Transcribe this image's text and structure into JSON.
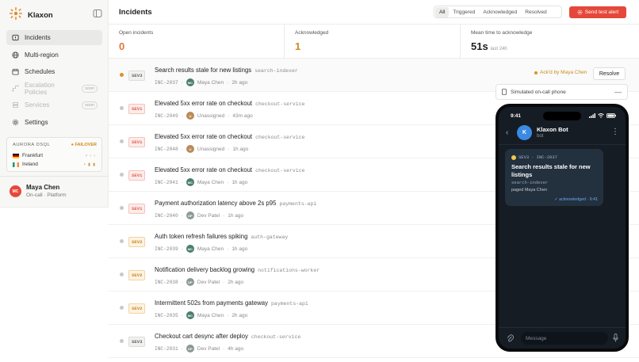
{
  "app": {
    "name": "Klaxon"
  },
  "sidebar": {
    "items": [
      {
        "label": "Incidents",
        "icon": "alert-triangle-icon",
        "active": true
      },
      {
        "label": "Multi-region",
        "icon": "globe-icon"
      },
      {
        "label": "Schedules",
        "icon": "calendar-icon"
      },
      {
        "label": "Escalation Policies",
        "icon": "escalation-icon",
        "disabled": true,
        "badge": "soon"
      },
      {
        "label": "Services",
        "icon": "server-icon",
        "disabled": true,
        "badge": "soon"
      },
      {
        "label": "Settings",
        "icon": "gear-icon"
      }
    ],
    "aurora": {
      "title": "AURORA DSQL",
      "status": "FAILOVER",
      "regions": [
        {
          "name": "Frankfurt",
          "flag": "DE",
          "state": "• ‹ ‹"
        },
        {
          "name": "Ireland",
          "flag": "IE",
          "state": "• ▮ ▮"
        }
      ]
    },
    "user": {
      "initials": "MC",
      "name": "Maya Chen",
      "role": "On-call · Platform"
    }
  },
  "header": {
    "title": "Incidents",
    "filters": [
      "All",
      "Triggered",
      "Acknowledged",
      "Resolved"
    ],
    "active_filter": "All",
    "send_test": "Send test alert"
  },
  "stats": [
    {
      "label": "Open incidents",
      "value": "0",
      "color": "#e2753d"
    },
    {
      "label": "Acknowledged",
      "value": "1",
      "color": "#c98c1d"
    },
    {
      "label": "Mean time to acknowledge",
      "value": "51s",
      "sub": "last 24h",
      "color": "#1f1f1f"
    }
  ],
  "incidents": [
    {
      "sev": "SEV3",
      "title": "Search results stale for new listings",
      "service": "search-indexer",
      "id": "INC-2037",
      "assignee": "Maya Chen",
      "initials": "MC",
      "time": "2h ago",
      "ack": "Ack'd by Maya Chen",
      "resolve": "Resolve",
      "dot": "#d9941c"
    },
    {
      "sev": "SEV1",
      "title": "Elevated 5xx error rate on checkout",
      "service": "checkout-service",
      "id": "INC-2049",
      "assignee": "Unassigned",
      "initials": "U",
      "time": "43m ago",
      "dot": "#c9c9c9"
    },
    {
      "sev": "SEV1",
      "title": "Elevated 5xx error rate on checkout",
      "service": "checkout-service",
      "id": "INC-2048",
      "assignee": "Unassigned",
      "initials": "U",
      "time": "1h ago",
      "dot": "#c9c9c9"
    },
    {
      "sev": "SEV1",
      "title": "Elevated 5xx error rate on checkout",
      "service": "checkout-service",
      "id": "INC-2041",
      "assignee": "Maya Chen",
      "initials": "MC",
      "time": "1h ago",
      "dot": "#c9c9c9"
    },
    {
      "sev": "SEV1",
      "title": "Payment authorization latency above 2s p95",
      "service": "payments-api",
      "id": "INC-2040",
      "assignee": "Dev Patel",
      "initials": "DP",
      "time": "1h ago",
      "dot": "#c9c9c9"
    },
    {
      "sev": "SEV2",
      "title": "Auth token refresh failures spiking",
      "service": "auth-gateway",
      "id": "INC-2039",
      "assignee": "Maya Chen",
      "initials": "MC",
      "time": "1h ago",
      "dot": "#c9c9c9"
    },
    {
      "sev": "SEV2",
      "title": "Notification delivery backlog growing",
      "service": "notifications-worker",
      "id": "INC-2038",
      "assignee": "Dev Patel",
      "initials": "DP",
      "time": "2h ago",
      "dot": "#c9c9c9"
    },
    {
      "sev": "SEV2",
      "title": "Intermittent 502s from payments gateway",
      "service": "payments-api",
      "id": "INC-2035",
      "assignee": "Maya Chen",
      "initials": "MC",
      "time": "2h ago",
      "dot": "#c9c9c9"
    },
    {
      "sev": "SEV3",
      "title": "Checkout cart desync after deploy",
      "service": "checkout-service",
      "id": "INC-2031",
      "assignee": "Dev Patel",
      "initials": "DP",
      "time": "4h ago",
      "dot": "#c9c9c9"
    }
  ],
  "sev_colors": {
    "SEV1": {
      "fg": "#e0614f",
      "bg": "#fdecea",
      "bd": "#f4c3bc"
    },
    "SEV2": {
      "fg": "#c98a1f",
      "bg": "#fdf3e3",
      "bd": "#efd5a6"
    },
    "SEV3": {
      "fg": "#666",
      "bg": "#f1f1f0",
      "bd": "#dcdcda"
    }
  },
  "avatar_colors": {
    "MC": "#4d7d6b",
    "U": "#b98b5a",
    "DP": "#8a9a92"
  },
  "phone_panel": {
    "label": "Simulated on-call phone",
    "minimize": "—"
  },
  "phone": {
    "time": "9:41",
    "bot_name": "Klaxon Bot",
    "bot_sub": "bot",
    "bot_initial": "K",
    "message": {
      "sev": "SEV3",
      "id": "INC-2037",
      "title": "Search results stale for new listings",
      "service": "search-indexer",
      "paged": "paged Maya Chen",
      "status": "✓ acknowledged · 9:41"
    },
    "input_placeholder": "Message"
  }
}
